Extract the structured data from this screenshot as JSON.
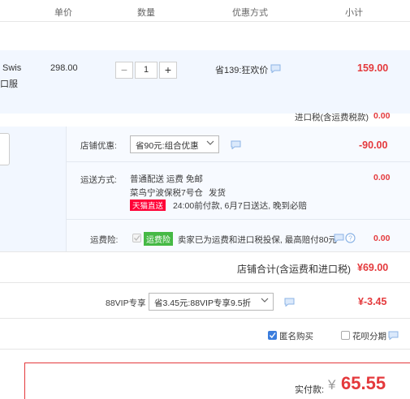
{
  "header": {
    "unit_price": "单价",
    "quantity": "数量",
    "discount": "优惠方式",
    "subtotal": "小计"
  },
  "item": {
    "name_line1": "Swis",
    "name_line2": "口服",
    "unit_price": "298.00",
    "quantity": "1",
    "minus": "−",
    "plus": "+",
    "discount": "省139:狂欢价",
    "subtotal": "159.00"
  },
  "import_tax": {
    "label": "进口税(含运费税款)",
    "value": "0.00"
  },
  "shop_discount": {
    "label": "店铺优惠:",
    "selected": "省90元:组合优惠",
    "value": "-90.00"
  },
  "shipping": {
    "label": "运送方式:",
    "method": "普通配送 运费 免邮",
    "warehouse": "菜鸟宁波保税7号仓",
    "dispatch": "发货",
    "tmall_tag": "天猫直送",
    "delivery_note": "24:00前付款, 6月7日送达, 晚到必赔",
    "value": "0.00"
  },
  "insurance": {
    "label": "运费险:",
    "tag": "运费险",
    "text": "卖家已为运费和进口税投保, 最高赔付80元",
    "value": "0.00"
  },
  "shop_total": {
    "label": "店铺合计(含运费和进口税)",
    "value": "¥69.00"
  },
  "vip": {
    "label": "88VIP专享",
    "selected": "省3.45元:88VIP专享9.5折",
    "value": "¥-3.45"
  },
  "options": {
    "anonymous": "匿名购买",
    "installment": "花呗分期"
  },
  "payment": {
    "label": "实付款:",
    "currency": "¥",
    "amount": "65.55"
  },
  "colors": {
    "accent_red": "#e4393c",
    "band_blue": "#f2f7ff",
    "green_tag": "#45b945",
    "tmall_red": "#ff0036",
    "checkbox_blue": "#3b7ddd"
  }
}
